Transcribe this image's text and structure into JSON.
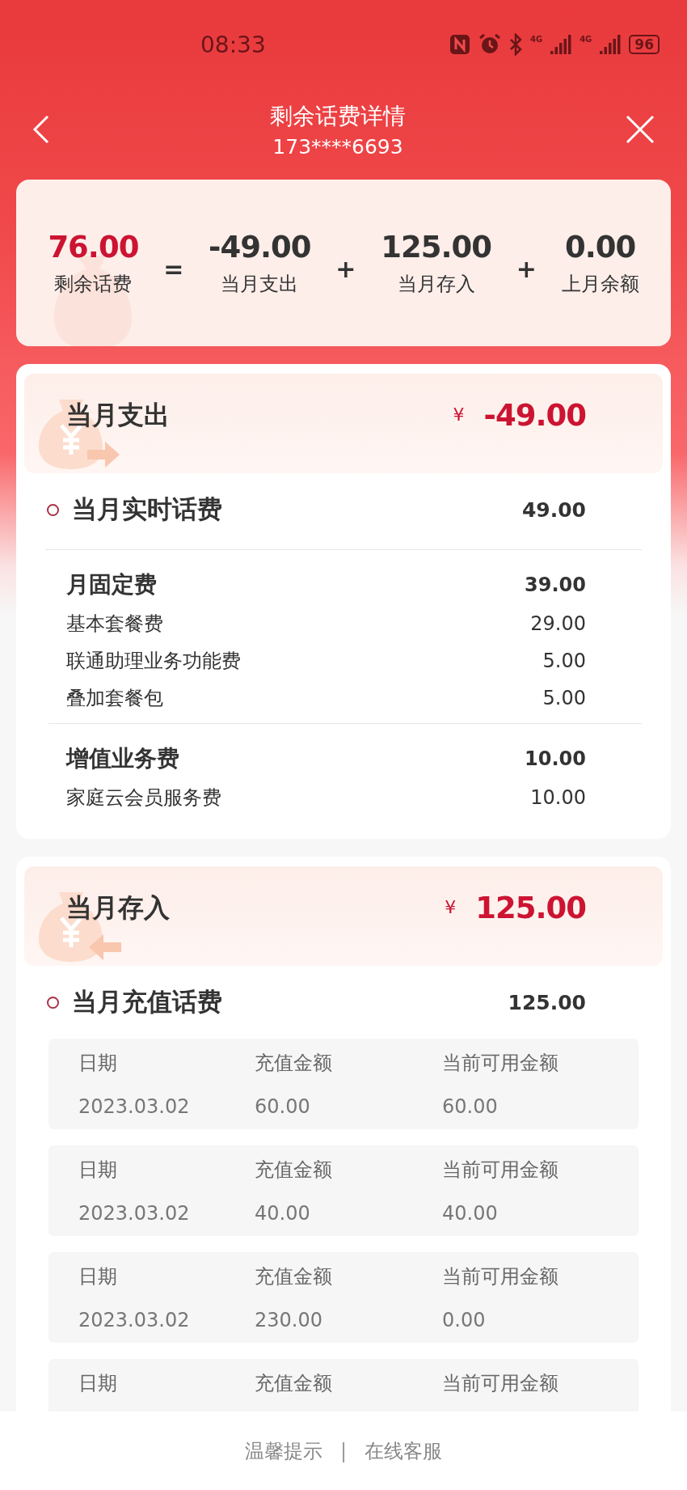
{
  "status_bar": {
    "time": "08:33",
    "network": [
      "4G",
      "4G"
    ],
    "battery": "96"
  },
  "header": {
    "title": "剩余话费详情",
    "subtitle": "173****6693"
  },
  "summary": {
    "terms": [
      {
        "value": "76.00",
        "label": "剩余话费",
        "highlight": true
      },
      {
        "operator": "=",
        "value": "-49.00",
        "label": "当月支出",
        "highlight": false
      },
      {
        "operator": "+",
        "value": "125.00",
        "label": "当月存入",
        "highlight": false
      },
      {
        "operator": "+",
        "value": "0.00",
        "label": "上月余额",
        "highlight": false
      }
    ]
  },
  "sections": [
    {
      "kind": "expense",
      "title": "当月支出",
      "currency": "¥",
      "amount": "-49.00",
      "subtotal": {
        "label": "当月实时话费",
        "amount": "49.00"
      },
      "groups": [
        {
          "title": "月固定费",
          "amount": "39.00",
          "items": [
            {
              "label": "基本套餐费",
              "amount": "29.00"
            },
            {
              "label": "联通助理业务功能费",
              "amount": "5.00"
            },
            {
              "label": "叠加套餐包",
              "amount": "5.00"
            }
          ]
        },
        {
          "title": "增值业务费",
          "amount": "10.00",
          "items": [
            {
              "label": "家庭云会员服务费",
              "amount": "10.00"
            }
          ]
        }
      ]
    },
    {
      "kind": "deposit",
      "title": "当月存入",
      "currency": "¥",
      "amount": "125.00",
      "subtotal": {
        "label": "当月充值话费",
        "amount": "125.00"
      },
      "records": [
        {
          "date_label": "日期",
          "date": "2023.03.02",
          "amount_label": "充值金额",
          "amount": "60.00",
          "available_label": "当前可用金额",
          "available": "60.00"
        },
        {
          "date_label": "日期",
          "date": "2023.03.02",
          "amount_label": "充值金额",
          "amount": "40.00",
          "available_label": "当前可用金额",
          "available": "40.00"
        },
        {
          "date_label": "日期",
          "date": "2023.03.02",
          "amount_label": "充值金额",
          "amount": "230.00",
          "available_label": "当前可用金额",
          "available": "0.00"
        },
        {
          "date_label": "日期",
          "amount_label": "充值金额",
          "available_label": "当前可用金额"
        }
      ]
    }
  ],
  "footer": {
    "links": [
      "温馨提示",
      "在线客服"
    ],
    "separator": "|"
  }
}
